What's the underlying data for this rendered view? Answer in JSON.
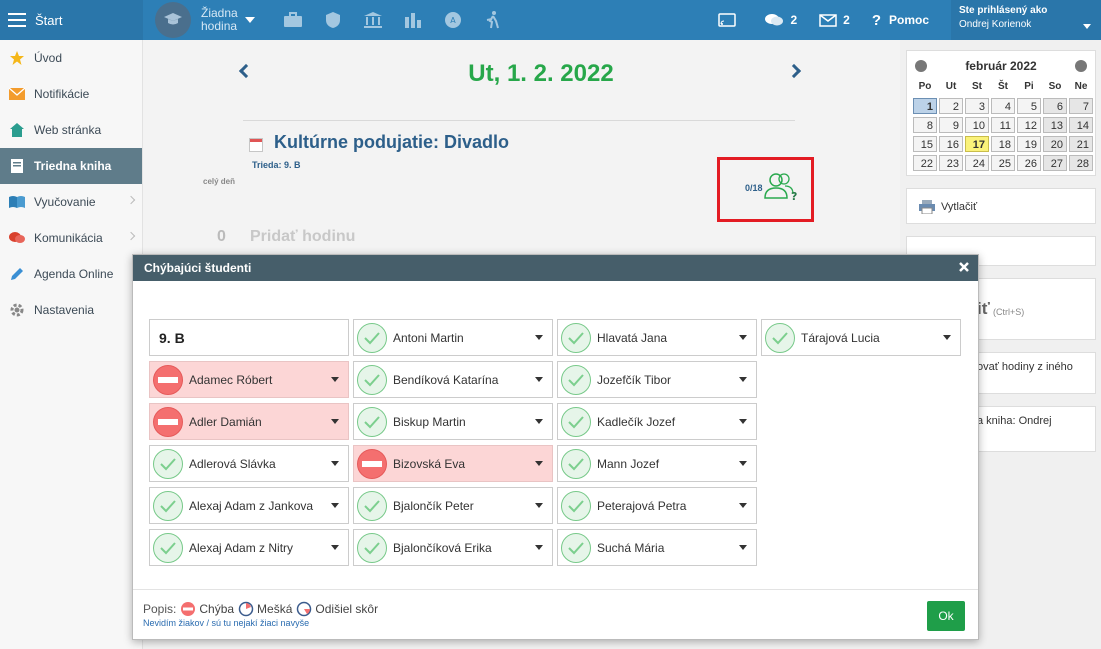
{
  "topbar": {
    "start_label": "Štart",
    "lesson_label": "Žiadna hodina",
    "messages_count": "2",
    "mail_count": "2",
    "help_label": "Pomoc",
    "user_label": "Ste prihlásený ako",
    "user_name": "Ondrej Korienok",
    "accent": "#2d7fb6"
  },
  "sidebar": {
    "items": [
      {
        "label": "Úvod",
        "icon": "star-icon"
      },
      {
        "label": "Notifikácie",
        "icon": "envelope-icon"
      },
      {
        "label": "Web stránka",
        "icon": "home-icon"
      },
      {
        "label": "Triedna kniha",
        "icon": "book-icon",
        "active": true
      },
      {
        "label": "Vyučovanie",
        "icon": "open-book-icon"
      },
      {
        "label": "Komunikácia",
        "icon": "chat-icon"
      },
      {
        "label": "Agenda Online",
        "icon": "pen-icon"
      },
      {
        "label": "Nastavenia",
        "icon": "gear-icon"
      }
    ]
  },
  "main": {
    "date_title": "Ut, 1. 2. 2022",
    "event_title": "Kultúrne podujatie: Divadlo",
    "event_class": "Trieda:  9. B",
    "allday": "celý deň",
    "attendance": "0/18",
    "add_num": "0",
    "add_text": "Pridať hodinu"
  },
  "calendar": {
    "month": "február 2022",
    "dow": [
      "Po",
      "Ut",
      "St",
      "Št",
      "Pi",
      "So",
      "Ne"
    ],
    "days": [
      "1",
      "2",
      "3",
      "4",
      "5",
      "6",
      "7",
      "8",
      "9",
      "10",
      "11",
      "12",
      "13",
      "14",
      "15",
      "16",
      "17",
      "18",
      "19",
      "20",
      "21",
      "22",
      "23",
      "24",
      "25",
      "26",
      "27",
      "28"
    ],
    "selected": "1",
    "today": "17"
  },
  "right_buttons": {
    "print": "Vytlačiť",
    "save_fragment": "iť",
    "save_hint": "(Ctrl+S)",
    "copy_fragment": "ovať hodiny z iného",
    "book_fragment": "a kniha: Ondrej"
  },
  "modal": {
    "title": "Chýbajúci študenti",
    "class_label": "9. B",
    "students": [
      {
        "name": "Adamec Róbert",
        "status": "absent"
      },
      {
        "name": "Adler Damián",
        "status": "absent"
      },
      {
        "name": "Adlerová Slávka",
        "status": "present"
      },
      {
        "name": "Alexaj Adam z Jankova",
        "status": "present"
      },
      {
        "name": "Alexaj Adam z Nitry",
        "status": "present"
      },
      {
        "name": "Antoni Martin",
        "status": "present"
      },
      {
        "name": "Bendíková Katarína",
        "status": "present"
      },
      {
        "name": "Biskup Martin",
        "status": "present"
      },
      {
        "name": "Bizovská Eva",
        "status": "absent"
      },
      {
        "name": "Bjalončík Peter",
        "status": "present"
      },
      {
        "name": "Bjalončíková Erika",
        "status": "present"
      },
      {
        "name": "Hlavatá Jana",
        "status": "present"
      },
      {
        "name": "Jozefčík Tibor",
        "status": "present"
      },
      {
        "name": "Kadlečík Jozef",
        "status": "present"
      },
      {
        "name": "Mann Jozef",
        "status": "present"
      },
      {
        "name": "Peterajová Petra",
        "status": "present"
      },
      {
        "name": "Suchá Mária",
        "status": "present"
      },
      {
        "name": "Tárajová Lucia",
        "status": "present"
      }
    ],
    "legend_prefix": "Popis:",
    "legend_absent": "Chýba",
    "legend_late": "Mešká",
    "legend_left": "Odišiel skôr",
    "link_text": "Nevidím žiakov / sú tu nejakí žiaci navyše",
    "ok_label": "Ok"
  }
}
